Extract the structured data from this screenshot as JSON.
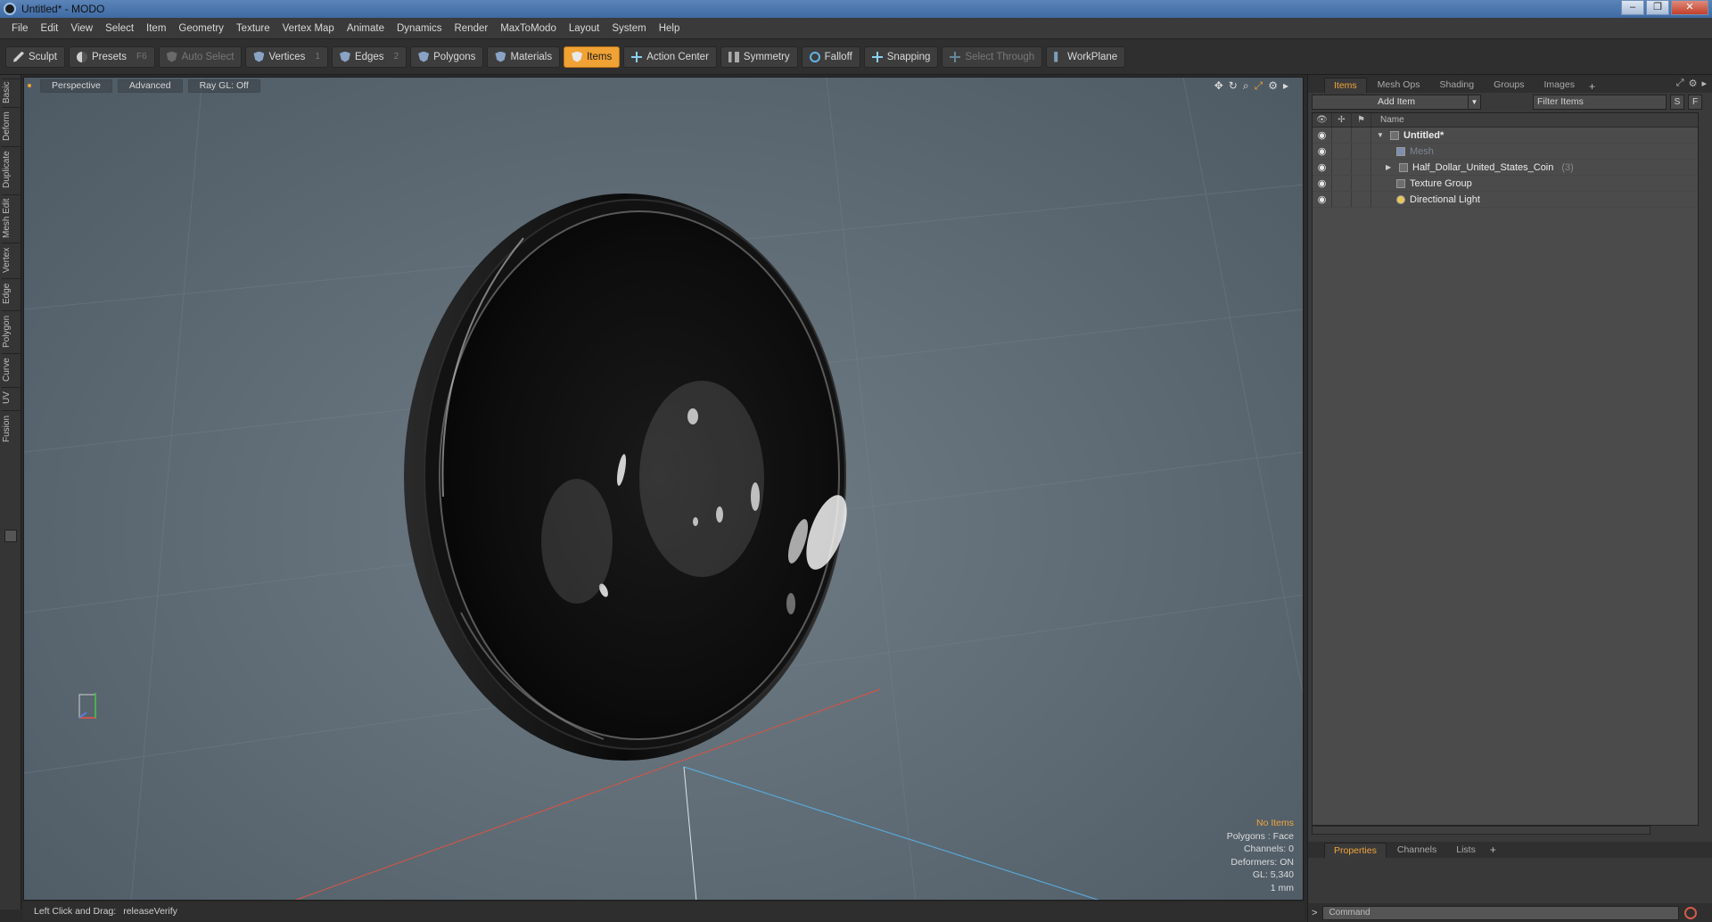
{
  "window": {
    "title": "Untitled* - MODO",
    "controls": [
      "–",
      "❐",
      "✕"
    ]
  },
  "menu": [
    "File",
    "Edit",
    "View",
    "Select",
    "Item",
    "Geometry",
    "Texture",
    "Vertex Map",
    "Animate",
    "Dynamics",
    "Render",
    "MaxToModo",
    "Layout",
    "System",
    "Help"
  ],
  "toolbar": {
    "sculpt": "Sculpt",
    "presets": "Presets",
    "presets_key": "F6",
    "auto_select": "Auto Select",
    "vertices": "Vertices",
    "vertices_key": "1",
    "edges": "Edges",
    "edges_key": "2",
    "polygons": "Polygons",
    "materials": "Materials",
    "items": "Items",
    "action_center": "Action Center",
    "symmetry": "Symmetry",
    "falloff": "Falloff",
    "snapping": "Snapping",
    "select_through": "Select Through",
    "workplane": "WorkPlane"
  },
  "left_tabs": [
    "Basic",
    "Deform",
    "Duplicate",
    "Mesh Edit",
    "Vertex",
    "Edge",
    "Polygon",
    "Curve",
    "UV",
    "Fusion"
  ],
  "viewport": {
    "tabs": [
      "Perspective",
      "Advanced",
      "Ray GL: Off"
    ],
    "info": {
      "selection": "No Items",
      "polygons": "Polygons : Face",
      "channels": "Channels: 0",
      "deformers": "Deformers: ON",
      "gl": "GL: 5,340",
      "scale": "1 mm"
    }
  },
  "status": {
    "label": "Left Click and Drag:",
    "value": "releaseVerify"
  },
  "right_panel": {
    "tabs": [
      "Items",
      "Mesh Ops",
      "Shading",
      "Groups",
      "Images"
    ],
    "add_item": "Add Item",
    "filter_placeholder": "Filter Items",
    "s_btn": "S",
    "f_btn": "F",
    "name_header": "Name",
    "tree": [
      {
        "label": "Untitled*"
      },
      {
        "label": "Mesh"
      },
      {
        "label": "Half_Dollar_United_States_Coin",
        "count": "(3)"
      },
      {
        "label": "Texture Group"
      },
      {
        "label": "Directional Light"
      }
    ],
    "bottom_tabs": [
      "Properties",
      "Channels",
      "Lists"
    ],
    "command_prompt": ">",
    "command_placeholder": "Command"
  },
  "colors": {
    "accent": "#f0a235",
    "viewport_bg": "#5d6a74",
    "panel_bg": "#3a3a3a"
  }
}
